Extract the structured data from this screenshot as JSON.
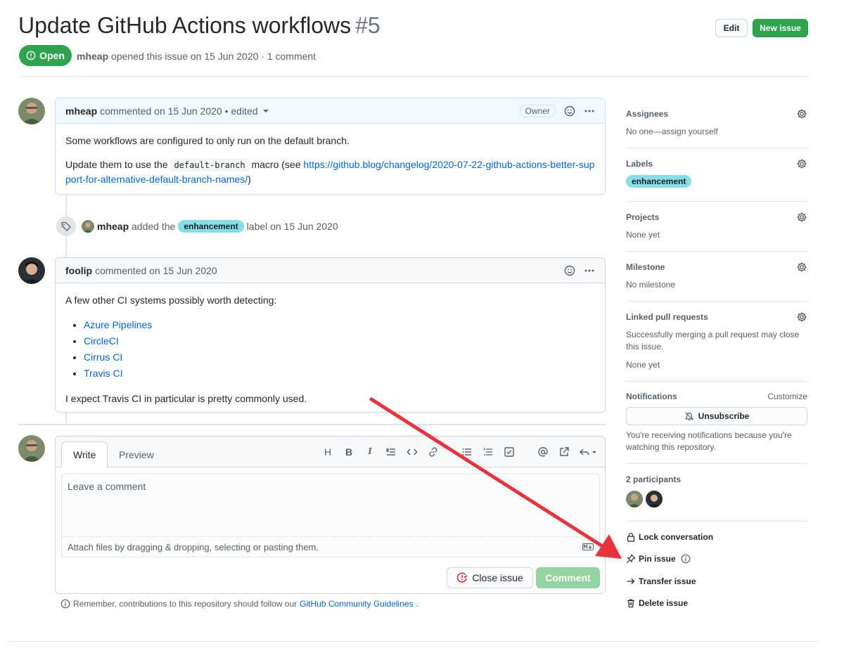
{
  "issue": {
    "title": "Update GitHub Actions workflows",
    "number": "#5",
    "state": "Open",
    "author": "mheap",
    "opened_text": "opened this issue on 15 Jun 2020 · 1 comment"
  },
  "header": {
    "edit_label": "Edit",
    "new_issue_label": "New issue"
  },
  "comments": [
    {
      "author": "mheap",
      "meta": "commented on 15 Jun 2020 • edited",
      "badge": "Owner",
      "p1": "Some workflows are configured to only run on the default branch.",
      "p2_before": "Update them to use the",
      "p2_code": "default-branch",
      "p2_mid": "macro (see",
      "p2_link": "https://github.blog/changelog/2020-07-22-github-actions-better-support-for-alternative-default-branch-names/",
      "p2_after": ")"
    },
    {
      "author": "foolip",
      "meta": "commented on 15 Jun 2020",
      "intro": "A few other CI systems possibly worth detecting:",
      "items": [
        "Azure Pipelines",
        "CircleCI",
        "Cirrus CI",
        "Travis CI"
      ],
      "outro": "I expect Travis CI in particular is pretty commonly used."
    }
  ],
  "label_event": {
    "actor": "mheap",
    "added_text": "added the",
    "label": "enhancement",
    "suffix": "label on 15 Jun 2020"
  },
  "editor": {
    "tab_write": "Write",
    "tab_preview": "Preview",
    "placeholder": "Leave a comment",
    "attach_text": "Attach files by dragging & dropping, selecting or pasting them.",
    "close_label": "Close issue",
    "comment_label": "Comment"
  },
  "guidelines": {
    "text": "Remember, contributions to this repository should follow our",
    "link": "GitHub Community Guidelines",
    "end": "."
  },
  "sidebar": {
    "assignees": {
      "title": "Assignees",
      "value": "No one—assign yourself"
    },
    "labels": {
      "title": "Labels",
      "value": "enhancement"
    },
    "projects": {
      "title": "Projects",
      "value": "None yet"
    },
    "milestone": {
      "title": "Milestone",
      "value": "No milestone"
    },
    "linked": {
      "title": "Linked pull requests",
      "value": "Successfully merging a pull request may close this issue.",
      "value2": "None yet"
    },
    "notifications": {
      "title": "Notifications",
      "customize": "Customize",
      "button": "Unsubscribe",
      "note": "You're receiving notifications because you're watching this repository."
    },
    "participants": {
      "title": "2 participants"
    },
    "actions": {
      "lock": "Lock conversation",
      "pin": "Pin issue",
      "transfer": "Transfer issue",
      "delete": "Delete issue"
    }
  },
  "colors": {
    "open": "#2ea44f",
    "link": "#0366d6",
    "label": "#84e0e6",
    "annotation_arrow": "#e8323c"
  }
}
